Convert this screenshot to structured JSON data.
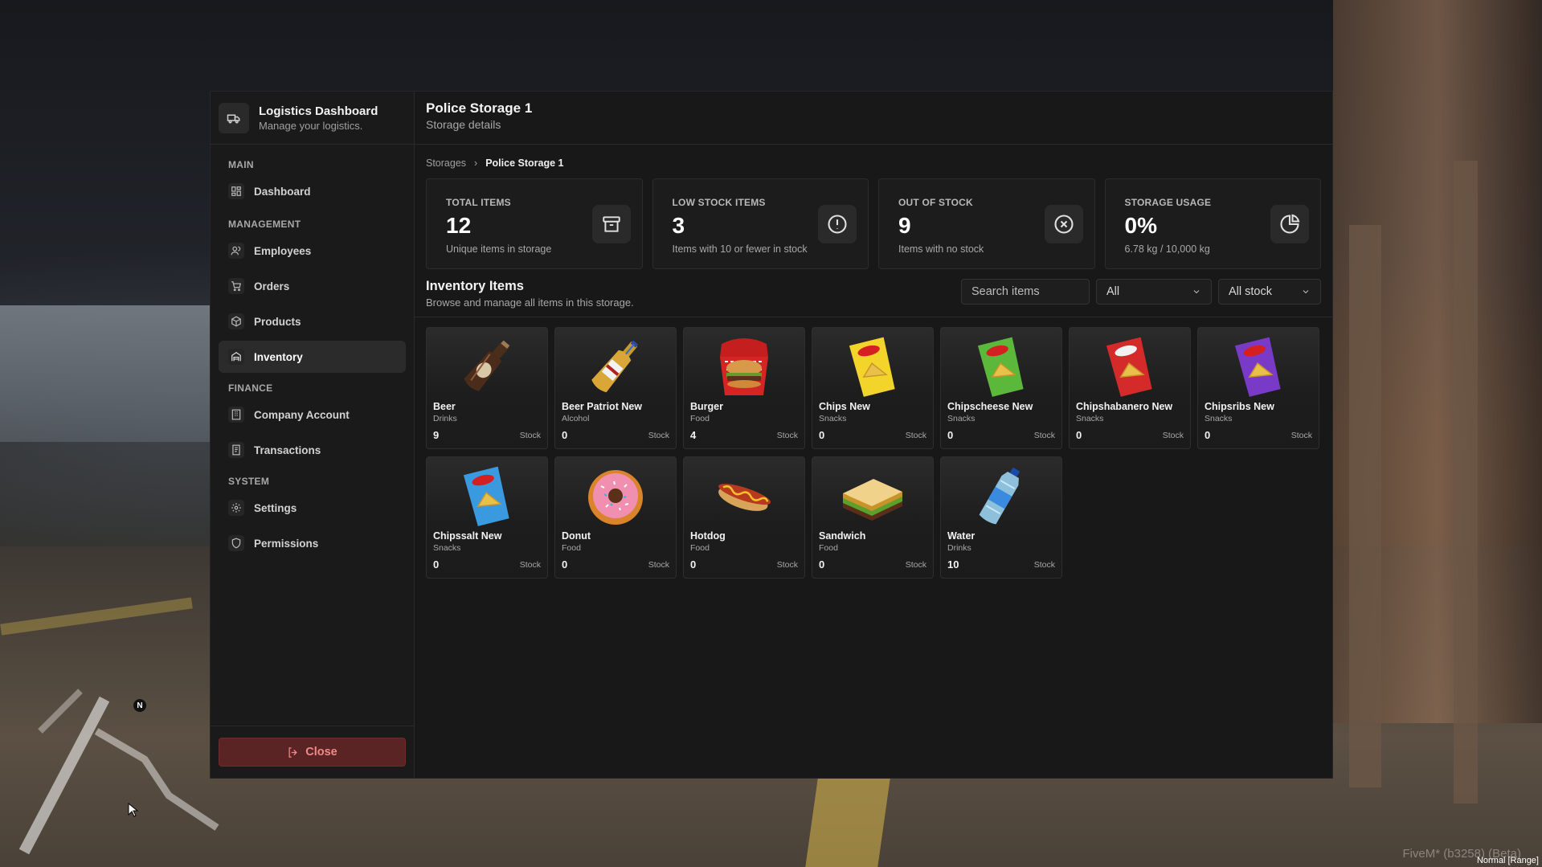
{
  "brand": {
    "title": "Logistics Dashboard",
    "subtitle": "Manage your logistics."
  },
  "nav": {
    "main_label": "MAIN",
    "dashboard": "Dashboard",
    "management_label": "MANAGEMENT",
    "employees": "Employees",
    "orders": "Orders",
    "products": "Products",
    "inventory": "Inventory",
    "finance_label": "FINANCE",
    "company_account": "Company Account",
    "transactions": "Transactions",
    "system_label": "SYSTEM",
    "settings": "Settings",
    "permissions": "Permissions",
    "close": "Close"
  },
  "header": {
    "title": "Police Storage 1",
    "subtitle": "Storage details"
  },
  "breadcrumb": {
    "parent": "Storages",
    "current": "Police Storage 1"
  },
  "stats": [
    {
      "label": "TOTAL ITEMS",
      "value": "12",
      "desc": "Unique items in storage",
      "icon": "archive-icon"
    },
    {
      "label": "LOW STOCK ITEMS",
      "value": "3",
      "desc": "Items with 10 or fewer in stock",
      "icon": "alert-circle-icon"
    },
    {
      "label": "OUT OF STOCK",
      "value": "9",
      "desc": "Items with no stock",
      "icon": "x-circle-icon"
    },
    {
      "label": "STORAGE USAGE",
      "value": "0%",
      "desc": "6.78 kg / 10,000 kg",
      "icon": "pie-chart-icon"
    }
  ],
  "inventory": {
    "title": "Inventory Items",
    "subtitle": "Browse and manage all items in this storage.",
    "search_placeholder": "Search items",
    "category_filter": "All",
    "stock_filter": "All stock",
    "stock_suffix": "Stock",
    "items": [
      {
        "name": "Beer",
        "category": "Drinks",
        "qty": "9"
      },
      {
        "name": "Beer Patriot New",
        "category": "Alcohol",
        "qty": "0"
      },
      {
        "name": "Burger",
        "category": "Food",
        "qty": "4"
      },
      {
        "name": "Chips New",
        "category": "Snacks",
        "qty": "0"
      },
      {
        "name": "Chipscheese New",
        "category": "Snacks",
        "qty": "0"
      },
      {
        "name": "Chipshabanero New",
        "category": "Snacks",
        "qty": "0"
      },
      {
        "name": "Chipsribs New",
        "category": "Snacks",
        "qty": "0"
      },
      {
        "name": "Chipssalt New",
        "category": "Snacks",
        "qty": "0"
      },
      {
        "name": "Donut",
        "category": "Food",
        "qty": "0"
      },
      {
        "name": "Hotdog",
        "category": "Food",
        "qty": "0"
      },
      {
        "name": "Sandwich",
        "category": "Food",
        "qty": "0"
      },
      {
        "name": "Water",
        "category": "Drinks",
        "qty": "10"
      }
    ]
  },
  "hud": {
    "compass": "N",
    "version": "FiveM* (b3258) (Beta)",
    "range": "Normal [Range]"
  },
  "colors": {
    "panel": "#181818",
    "close_bg": "#5a2424",
    "close_text": "#f08a8a"
  }
}
